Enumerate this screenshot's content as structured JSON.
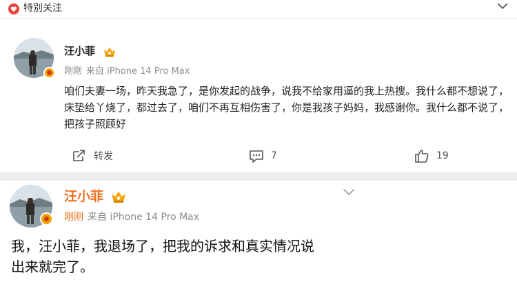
{
  "header": {
    "label": "特别关注"
  },
  "post1": {
    "author": "汪小菲",
    "time": "刚刚",
    "source": "来自 iPhone 14 Pro Max",
    "text": "咱们夫妻一场，昨天我急了，是你发起的战争，说我不给家用逼的我上热搜。我什么都不想说了，床垫给丫烧了，都过去了，咱们不再互相伤害了，你是我孩子妈妈，我感谢你。我什么都不说了，把孩子照顾好",
    "share_label": "转发",
    "comment_count": "7",
    "like_count": "19"
  },
  "post2": {
    "author": "汪小菲",
    "time": "刚刚",
    "source": "来自 iPhone 14 Pro Max",
    "text_line1": "我，汪小菲，我退场了，把我的诉求和真实情况说",
    "text_line2": "出来就完了。"
  },
  "colors": {
    "accent_orange": "#f0701e",
    "vip_gold": "#f4a100",
    "heart_red": "#e8423a"
  }
}
